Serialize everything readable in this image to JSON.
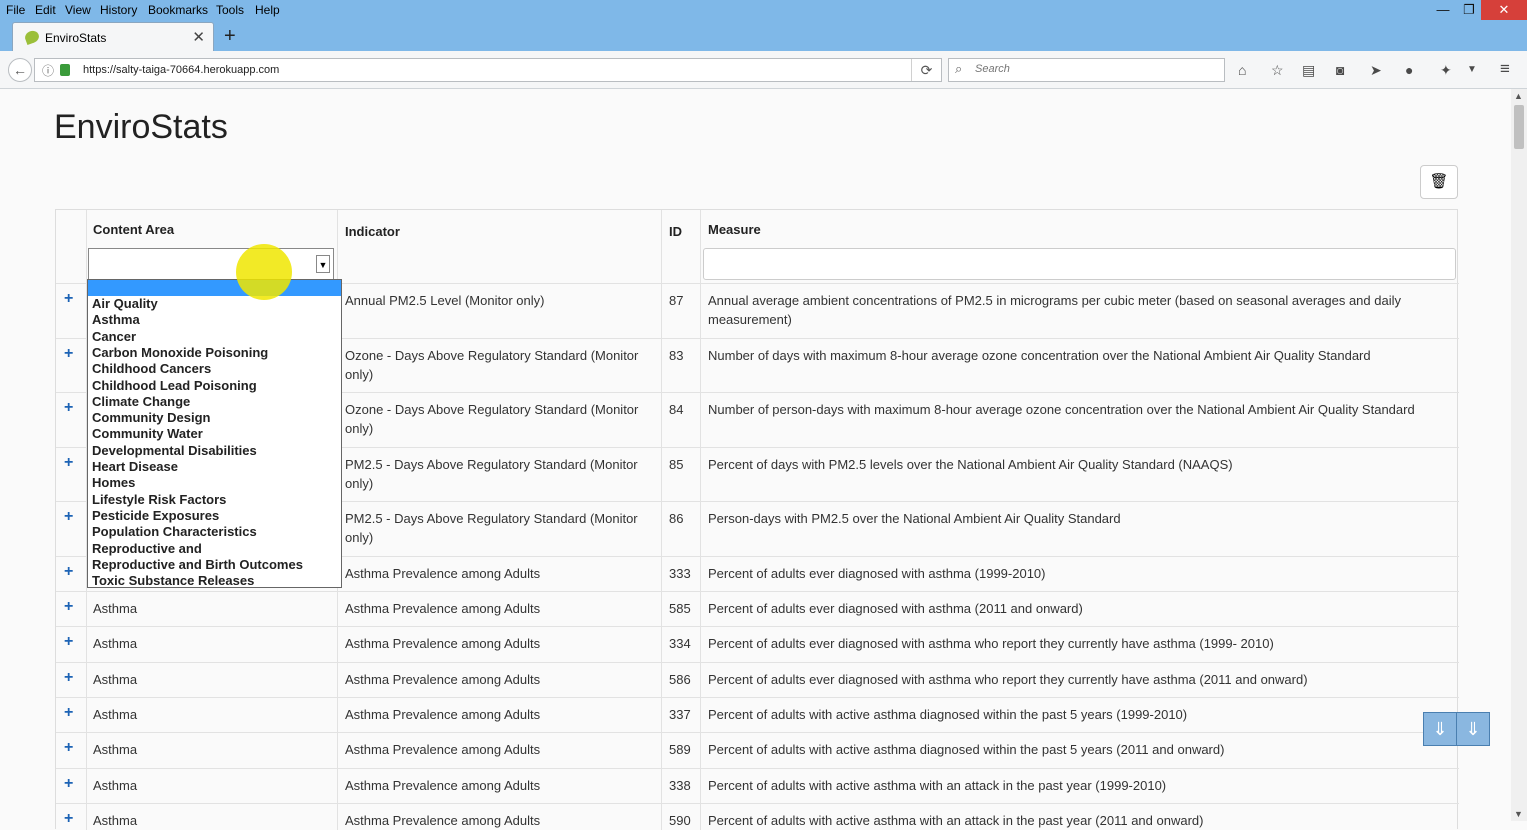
{
  "menubar": {
    "items": [
      "File",
      "Edit",
      "View",
      "History",
      "Bookmarks",
      "Tools",
      "Help"
    ]
  },
  "window_controls": {
    "minimize": "—",
    "restore": "❐",
    "close": "✕"
  },
  "tab": {
    "title": "EnviroStats",
    "close": "✕"
  },
  "newtab": "+",
  "navbar": {
    "url": "https://salty-taiga-70664.herokuapp.com",
    "search_placeholder": "Search"
  },
  "page": {
    "title": "EnviroStats",
    "trash_icon": "🗑"
  },
  "table": {
    "headers": {
      "content_area": "Content Area",
      "indicator": "Indicator",
      "id": "ID",
      "measure": "Measure"
    },
    "rows": [
      {
        "area": "",
        "indicator": "Annual PM2.5 Level (Monitor only)",
        "id": "87",
        "measure": "Annual average ambient concentrations of PM2.5 in micrograms per cubic meter (based on seasonal averages and daily measurement)"
      },
      {
        "area": "",
        "indicator": "Ozone - Days Above Regulatory Standard (Monitor only)",
        "id": "83",
        "measure": "Number of days with maximum 8-hour average ozone concentration over the National Ambient Air Quality Standard"
      },
      {
        "area": "",
        "indicator": "Ozone - Days Above Regulatory Standard (Monitor only)",
        "id": "84",
        "measure": "Number of person-days with maximum 8-hour average ozone concentration over the National Ambient Air Quality Standard"
      },
      {
        "area": "",
        "indicator": "PM2.5 - Days Above Regulatory Standard (Monitor only)",
        "id": "85",
        "measure": "Percent of days with PM2.5 levels over the National Ambient Air Quality Standard (NAAQS)"
      },
      {
        "area": "",
        "indicator": "PM2.5 - Days Above Regulatory Standard (Monitor only)",
        "id": "86",
        "measure": "Person-days with PM2.5 over the National Ambient Air Quality Standard"
      },
      {
        "area": "",
        "indicator": "Asthma Prevalence among Adults",
        "id": "333",
        "measure": "Percent of adults ever diagnosed with asthma (1999-2010)"
      },
      {
        "area": "Asthma",
        "indicator": "Asthma Prevalence among Adults",
        "id": "585",
        "measure": "Percent of adults ever diagnosed with asthma (2011 and onward)"
      },
      {
        "area": "Asthma",
        "indicator": "Asthma Prevalence among Adults",
        "id": "334",
        "measure": "Percent of adults ever diagnosed with asthma who report they currently have asthma (1999- 2010)"
      },
      {
        "area": "Asthma",
        "indicator": "Asthma Prevalence among Adults",
        "id": "586",
        "measure": "Percent of adults ever diagnosed with asthma who report they currently have asthma (2011 and onward)"
      },
      {
        "area": "Asthma",
        "indicator": "Asthma Prevalence among Adults",
        "id": "337",
        "measure": "Percent of adults with active asthma diagnosed within the past 5 years (1999-2010)"
      },
      {
        "area": "Asthma",
        "indicator": "Asthma Prevalence among Adults",
        "id": "589",
        "measure": "Percent of adults with active asthma diagnosed within the past 5 years (2011 and onward)"
      },
      {
        "area": "Asthma",
        "indicator": "Asthma Prevalence among Adults",
        "id": "338",
        "measure": "Percent of adults with active asthma with an attack in the past year (1999-2010)"
      },
      {
        "area": "Asthma",
        "indicator": "Asthma Prevalence among Adults",
        "id": "590",
        "measure": "Percent of adults with active asthma with an attack in the past year (2011 and onward)"
      }
    ]
  },
  "dropdown": {
    "options": [
      "Air Quality",
      "Asthma",
      "Cancer",
      "Carbon Monoxide Poisoning",
      "Childhood Cancers",
      "Childhood Lead Poisoning",
      "Climate Change",
      "Community Design",
      "Community Water",
      "Developmental Disabilities",
      "Heart Disease",
      "Homes",
      "Lifestyle Risk Factors",
      "Pesticide Exposures",
      "Population Characteristics",
      "Reproductive and",
      "Reproductive and Birth Outcomes",
      "Toxic Substance Releases"
    ]
  }
}
